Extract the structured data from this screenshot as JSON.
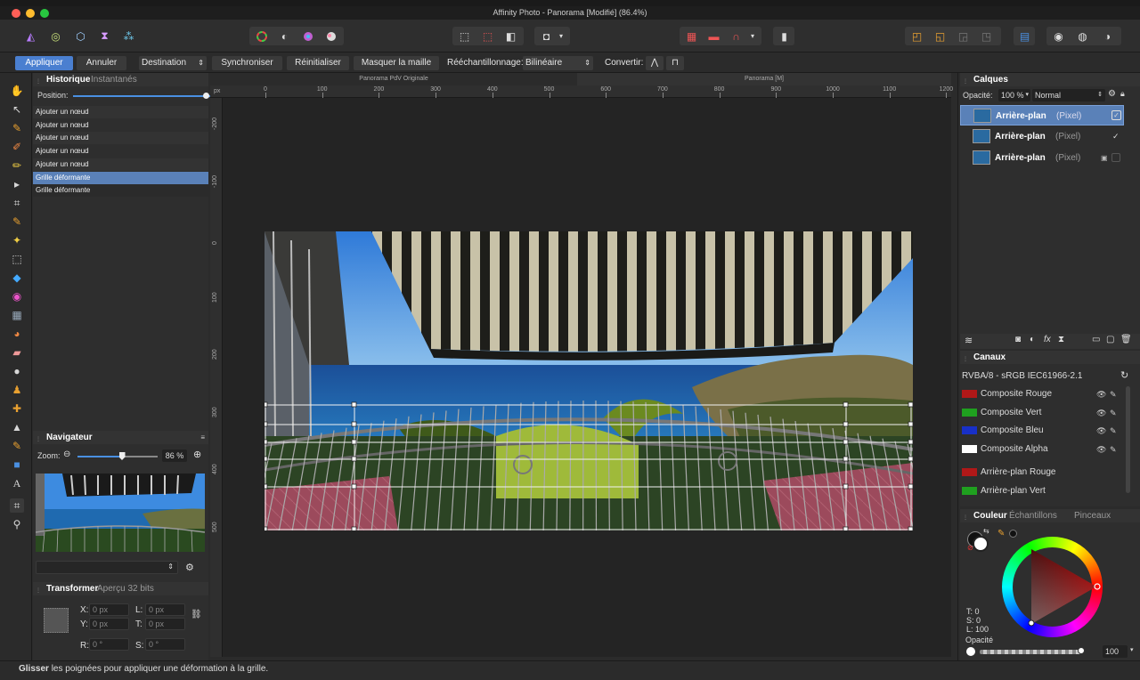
{
  "window": {
    "title": "Affinity Photo - Panorama [Modifié] (86.4%)"
  },
  "context_bar": {
    "apply": "Appliquer",
    "cancel": "Annuler",
    "destination": "Destination",
    "sync": "Synchroniser",
    "reset": "Réinitialiser",
    "mask_mesh": "Masquer la maille",
    "resample_label": "Rééchantillonnage:",
    "resample_value": "Bilinéaire",
    "convert_label": "Convertir:"
  },
  "history": {
    "tab_active": "Historique",
    "tab_inactive": "Instantanés",
    "position_label": "Position:",
    "position_fraction": 0.93,
    "items": [
      {
        "label": "Ajouter un nœud"
      },
      {
        "label": "Ajouter un nœud"
      },
      {
        "label": "Ajouter un nœud"
      },
      {
        "label": "Ajouter un nœud"
      },
      {
        "label": "Ajouter un nœud"
      },
      {
        "label": "Grille déformante"
      },
      {
        "label": "Grille déformante"
      }
    ]
  },
  "navigator": {
    "title": "Navigateur",
    "zoom_label": "Zoom:",
    "zoom_value": "86 %",
    "zoom_fraction": 0.55
  },
  "transform": {
    "tab_active": "Transformer",
    "tab_inactive": "Aperçu 32 bits",
    "x_label": "X:",
    "x_value": "0 px",
    "y_label": "Y:",
    "y_value": "0 px",
    "w_label": "L:",
    "w_value": "0 px",
    "h_label": "T:",
    "h_value": "0 px",
    "r_label": "R:",
    "r_value": "0 °",
    "s_label": "S:",
    "s_value": "0 °"
  },
  "document_tabs": {
    "left": "Panorama PdV Originale",
    "right": "Panorama [M]"
  },
  "ruler": {
    "unit": "px",
    "h_ticks": [
      "0",
      "100",
      "200",
      "300",
      "400",
      "500",
      "600",
      "700",
      "800",
      "900",
      "1000",
      "1100",
      "1200"
    ],
    "v_ticks": [
      "-200",
      "-100",
      "0",
      "100",
      "200",
      "300",
      "400",
      "500"
    ]
  },
  "layers": {
    "title": "Calques",
    "opacity_label": "Opacité:",
    "opacity_value": "100 %",
    "blend_mode": "Normal",
    "items": [
      {
        "name": "Arrière-plan",
        "type": "(Pixel)"
      },
      {
        "name": "Arrière-plan",
        "type": "(Pixel)"
      },
      {
        "name": "Arrière-plan",
        "type": "(Pixel)"
      }
    ]
  },
  "channels": {
    "title": "Canaux",
    "profile": "RVBA/8 - sRGB IEC61966-2.1",
    "items": [
      {
        "label": "Composite Rouge",
        "color": "#b01818"
      },
      {
        "label": "Composite Vert",
        "color": "#1fa01f"
      },
      {
        "label": "Composite Bleu",
        "color": "#1830c8"
      },
      {
        "label": "Composite Alpha",
        "color": "#ffffff"
      },
      {
        "label": "Arrière-plan Rouge",
        "color": "#b01818"
      },
      {
        "label": "Arrière-plan Vert",
        "color": "#1fa01f"
      }
    ]
  },
  "color_panel": {
    "tab_active": "Couleur",
    "tabs_inactive": [
      "Échantillons",
      "Pinceaux"
    ],
    "t_value": "T: 0",
    "s_value": "S: 0",
    "l_value": "L: 100",
    "opacity_label": "Opacité",
    "opacity_value": "100 %"
  },
  "status": {
    "bold": "Glisser",
    "text": " les poignées pour appliquer une déformation à la grille."
  }
}
